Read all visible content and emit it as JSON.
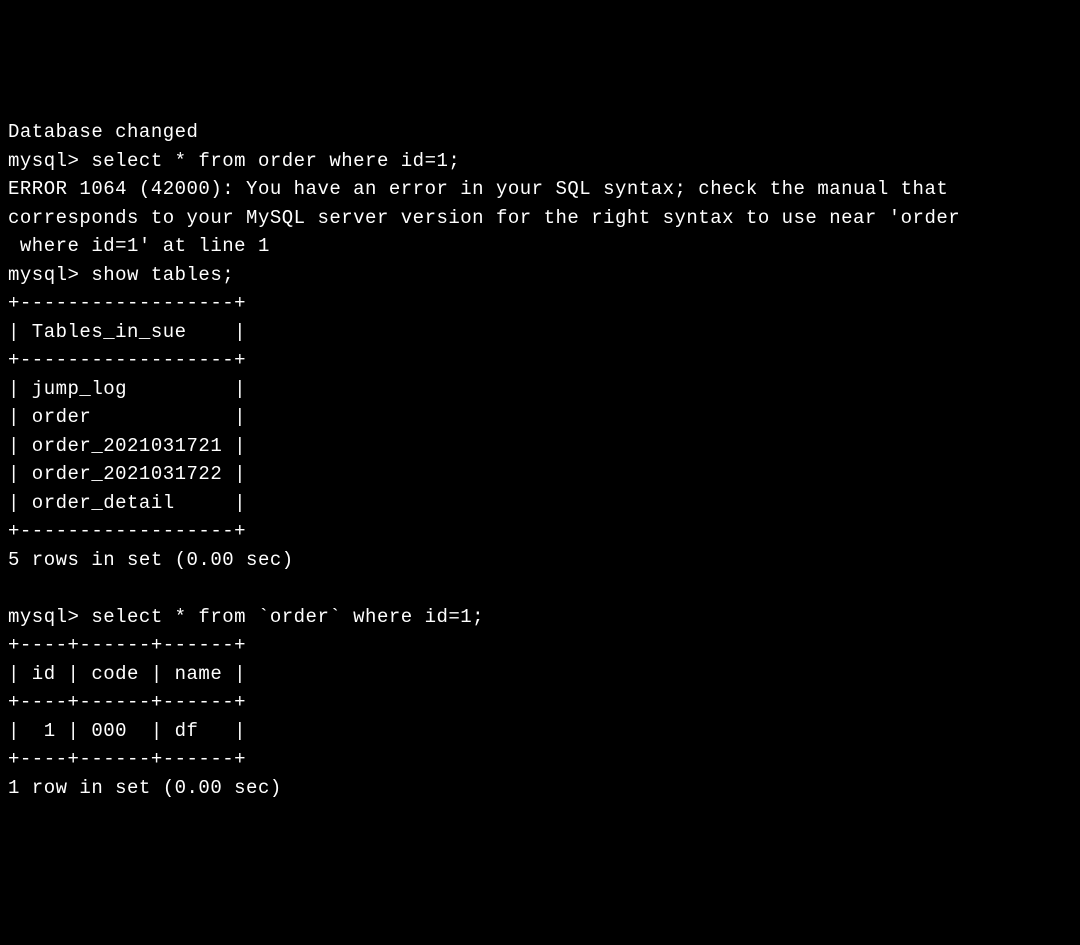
{
  "lines": {
    "l0": "Database changed",
    "l1": "mysql> select * from order where id=1;",
    "l2": "ERROR 1064 (42000): You have an error in your SQL syntax; check the manual that",
    "l3": "corresponds to your MySQL server version for the right syntax to use near 'order",
    "l4": " where id=1' at line 1",
    "l5": "mysql> show tables;",
    "l6": "+------------------+",
    "l7": "| Tables_in_sue    |",
    "l8": "+------------------+",
    "l9": "| jump_log         |",
    "l10": "| order            |",
    "l11": "| order_2021031721 |",
    "l12": "| order_2021031722 |",
    "l13": "| order_detail     |",
    "l14": "+------------------+",
    "l15": "5 rows in set (0.00 sec)",
    "l16": "",
    "l17": "mysql> select * from `order` where id=1;",
    "l18": "+----+------+------+",
    "l19": "| id | code | name |",
    "l20": "+----+------+------+",
    "l21": "|  1 | 000  | df   |",
    "l22": "+----+------+------+",
    "l23": "1 row in set (0.00 sec)"
  }
}
